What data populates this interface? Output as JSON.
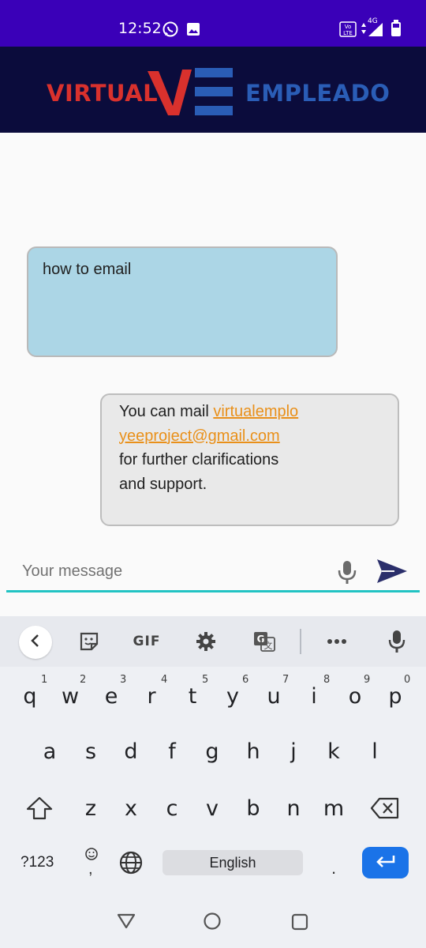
{
  "status_bar": {
    "time": "12:52",
    "icons": [
      "whatsapp-icon",
      "image-icon",
      "volte-icon",
      "data-arrows-icon",
      "signal-icon",
      "battery-icon"
    ],
    "network": "4G"
  },
  "header": {
    "logo_left": "VIRTUAL",
    "logo_right": "EMPLEADO",
    "colors": {
      "background": "#0b0c3c",
      "red": "#d9312d",
      "blue": "#2a5db6"
    }
  },
  "chat": {
    "user_message": "how to email",
    "bot_message": {
      "prefix": "You can mail ",
      "email": "virtualemployeeproject@gmail.com",
      "suffix": " for further clarifications and support."
    },
    "colors": {
      "user_bubble": "#acd6e6",
      "bot_bubble": "#e9e9e9",
      "link": "#e9901a"
    }
  },
  "composer": {
    "placeholder": "Your message",
    "value": "",
    "accent": "#21c3c3"
  },
  "keyboard": {
    "toolbar": [
      "back-icon",
      "sticker-icon",
      "GIF",
      "settings-icon",
      "translate-icon",
      "more-icon",
      "mic-icon"
    ],
    "gif_label": "GIF",
    "row1": [
      "q",
      "w",
      "e",
      "r",
      "t",
      "y",
      "u",
      "i",
      "o",
      "p"
    ],
    "row1_hints": [
      "1",
      "2",
      "3",
      "4",
      "5",
      "6",
      "7",
      "8",
      "9",
      "0"
    ],
    "row2": [
      "a",
      "s",
      "d",
      "f",
      "g",
      "h",
      "j",
      "k",
      "l"
    ],
    "row3": [
      "z",
      "x",
      "c",
      "v",
      "b",
      "n",
      "m"
    ],
    "symbols_label": "?123",
    "comma": ",",
    "space_label": "English",
    "period": ".",
    "enter_color": "#1a73e8"
  },
  "nav_bar": [
    "back-triangle-icon",
    "home-circle-icon",
    "recents-square-icon"
  ]
}
